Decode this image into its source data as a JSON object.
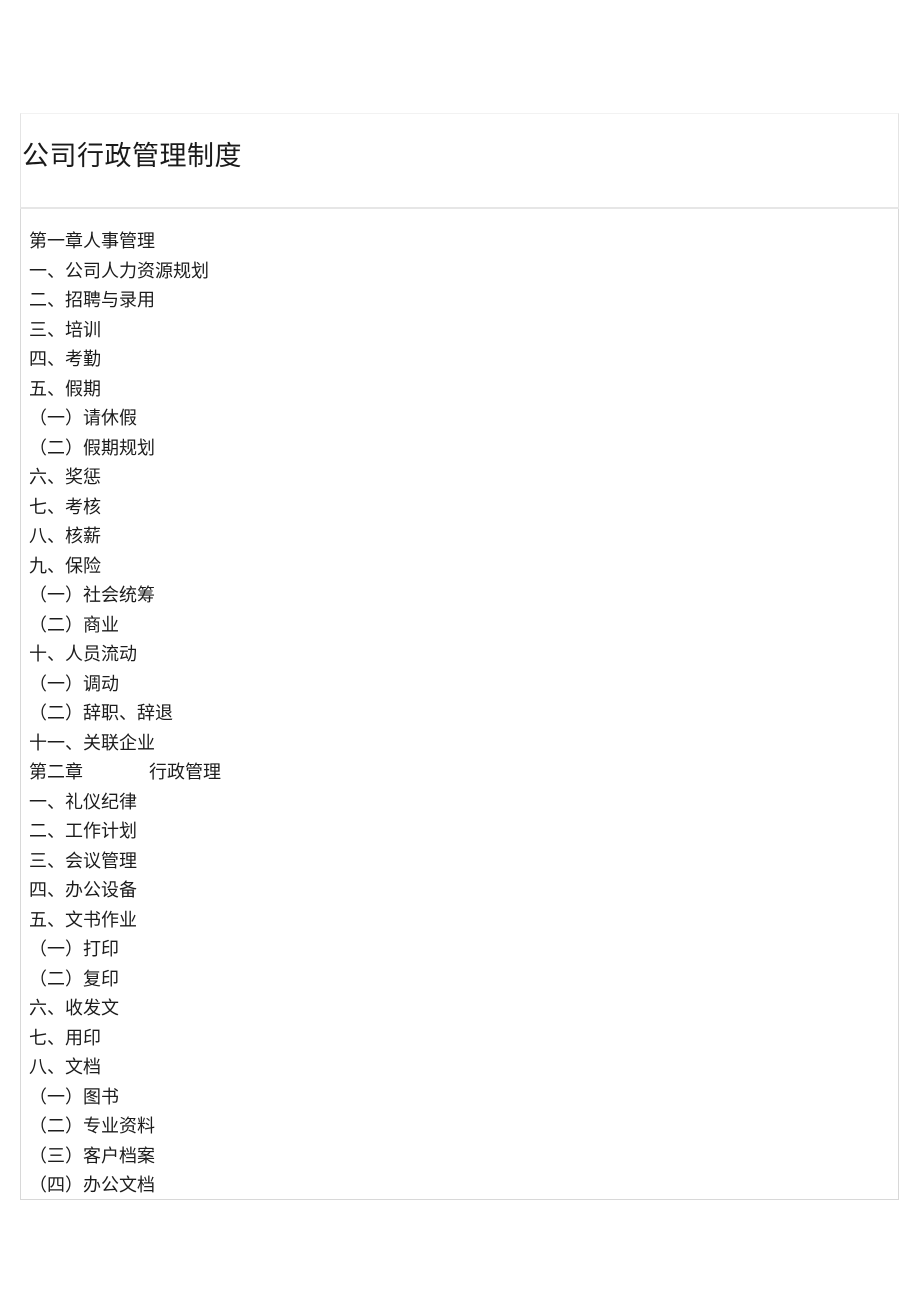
{
  "document": {
    "title": "公司行政管理制度",
    "toc": [
      {
        "text": "第一章人事管理",
        "level": "chapter"
      },
      {
        "text": "一、公司人力资源规划",
        "level": "section"
      },
      {
        "text": "二、招聘与录用",
        "level": "section"
      },
      {
        "text": "三、培训",
        "level": "section"
      },
      {
        "text": "四、考勤",
        "level": "section"
      },
      {
        "text": "五、假期",
        "level": "section"
      },
      {
        "text": "（一）请休假",
        "level": "sub"
      },
      {
        "text": "（二）假期规划",
        "level": "sub"
      },
      {
        "text": "六、奖惩",
        "level": "section"
      },
      {
        "text": "七、考核",
        "level": "section"
      },
      {
        "text": "八、核薪",
        "level": "section"
      },
      {
        "text": "九、保险",
        "level": "section"
      },
      {
        "text": "（一）社会统筹",
        "level": "sub"
      },
      {
        "text": "（二）商业",
        "level": "sub"
      },
      {
        "text": "十、人员流动",
        "level": "section"
      },
      {
        "text": "（一）调动",
        "level": "sub"
      },
      {
        "text": "（二）辞职、辞退",
        "level": "sub"
      },
      {
        "text": "十一、关联企业",
        "level": "section"
      },
      {
        "text": "第二章",
        "level": "chapter",
        "tail": "行政管理",
        "tab": true
      },
      {
        "text": "一、礼仪纪律",
        "level": "section"
      },
      {
        "text": "二、工作计划",
        "level": "section"
      },
      {
        "text": "三、会议管理",
        "level": "section"
      },
      {
        "text": "四、办公设备",
        "level": "section"
      },
      {
        "text": "五、文书作业",
        "level": "section"
      },
      {
        "text": "（一）打印",
        "level": "sub"
      },
      {
        "text": "（二）复印",
        "level": "sub"
      },
      {
        "text": "六、收发文",
        "level": "section"
      },
      {
        "text": "七、用印",
        "level": "section"
      },
      {
        "text": "八、文档",
        "level": "section"
      },
      {
        "text": "（一）图书",
        "level": "sub"
      },
      {
        "text": "（二）专业资料",
        "level": "sub"
      },
      {
        "text": "（三）客户档案",
        "level": "sub"
      },
      {
        "text": "（四）办公文档",
        "level": "sub"
      }
    ]
  },
  "colors": {
    "text": "#1c1c1c",
    "title": "#1a1a1a",
    "border": "#d8d8d8",
    "divider": "#e6e6e6",
    "background": "#ffffff"
  }
}
